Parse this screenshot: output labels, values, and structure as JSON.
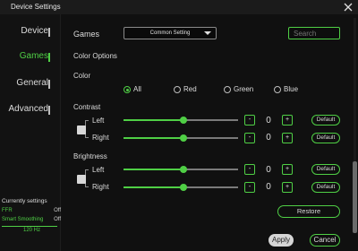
{
  "window": {
    "title": "Device Settings"
  },
  "sidebar": {
    "items": [
      {
        "label": "Device"
      },
      {
        "label": "Games"
      },
      {
        "label": "General"
      },
      {
        "label": "Advanced"
      }
    ],
    "active": "Games",
    "current_settings": {
      "title": "Currently settings",
      "rows": [
        {
          "key": "FFR",
          "value": "Off"
        },
        {
          "key": "Smart Smoothing",
          "value": "Off"
        }
      ],
      "refresh_rate": "120 Hz"
    }
  },
  "main": {
    "games_label": "Games",
    "dropdown_value": "Common Setting",
    "search_placeholder": "Search",
    "color_options_label": "Color Options",
    "color_label": "Color",
    "color_choices": [
      "All",
      "Red",
      "Green",
      "Blue"
    ],
    "color_selected": "All",
    "contrast": {
      "label": "Contrast",
      "left": {
        "label": "Left",
        "value": "0",
        "level": 0.52
      },
      "right": {
        "label": "Right",
        "value": "0",
        "level": 0.52
      }
    },
    "brightness": {
      "label": "Brightness",
      "left": {
        "label": "Left",
        "value": "0",
        "level": 0.52
      },
      "right": {
        "label": "Right",
        "value": "0",
        "level": 0.52
      }
    },
    "minus": "-",
    "plus": "+",
    "default_label": "Default",
    "restore_label": "Restore",
    "apply_label": "Apply",
    "cancel_label": "Cancel"
  },
  "colors": {
    "accent": "#4fcf45",
    "background": "#101010",
    "text": "#dcdcdc"
  }
}
